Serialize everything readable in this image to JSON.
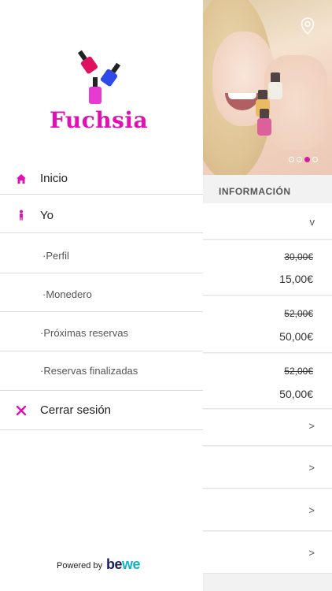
{
  "drawer": {
    "brand": {
      "name": "Fuchsia",
      "accent": "#e010b5"
    },
    "menu": [
      {
        "id": "inicio",
        "label": "Inicio",
        "icon": "home-icon"
      },
      {
        "id": "yo",
        "label": "Yo",
        "icon": "person-icon"
      },
      {
        "id": "perfil",
        "label": "·Perfil"
      },
      {
        "id": "monedero",
        "label": "·Monedero"
      },
      {
        "id": "proximas",
        "label": "·Próximas reservas"
      },
      {
        "id": "finalizadas",
        "label": "·Reservas finalizadas"
      },
      {
        "id": "cerrar",
        "label": "Cerrar sesión",
        "icon": "close-icon"
      }
    ],
    "powered_by": "Powered by",
    "partner_logo": {
      "part1": "be",
      "part2": "we"
    }
  },
  "underlay": {
    "section_title": "INFORMACIÓN",
    "carousel": {
      "pages": 4,
      "active_index": 2
    },
    "collapse_chevron": "v",
    "prices": [
      {
        "old": "30,00€",
        "new": "15,00€"
      },
      {
        "old": "52,00€",
        "new": "50,00€"
      },
      {
        "old": "52,00€",
        "new": "50,00€"
      }
    ],
    "row_chevron": ">"
  }
}
